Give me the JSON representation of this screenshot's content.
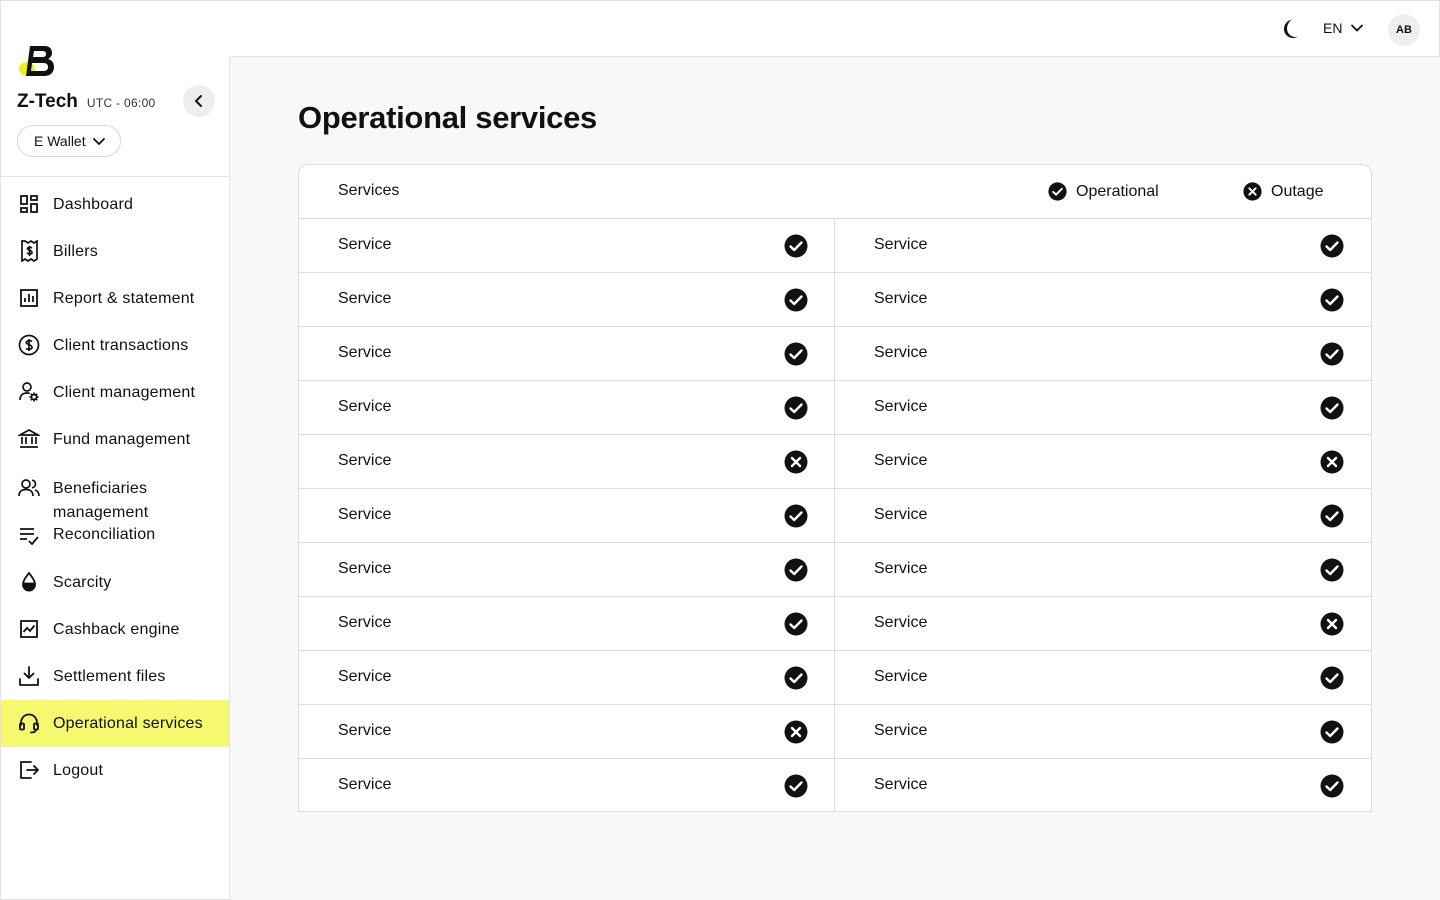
{
  "company": {
    "name": "Z-Tech",
    "timezone": "UTC - 06:00",
    "wallet": "E Wallet"
  },
  "topbar": {
    "language": "EN",
    "avatar_initials": "AB"
  },
  "nav": [
    {
      "label": "Dashboard",
      "icon": "dashboard-icon"
    },
    {
      "label": "Billers",
      "icon": "billers-icon"
    },
    {
      "label": "Report & statement",
      "icon": "report-icon"
    },
    {
      "label": "Client transactions",
      "icon": "dollar-icon"
    },
    {
      "label": "Client management",
      "icon": "user-gear-icon"
    },
    {
      "label": "Fund management",
      "icon": "bank-icon"
    },
    {
      "label": "Beneficiaries management",
      "icon": "users-icon"
    },
    {
      "label": "Reconciliation",
      "icon": "checklist-icon"
    },
    {
      "label": "Scarcity",
      "icon": "drop-icon"
    },
    {
      "label": "Cashback engine",
      "icon": "chart-line-icon"
    },
    {
      "label": "Settlement files",
      "icon": "download-icon"
    },
    {
      "label": "Operational services",
      "icon": "headset-icon",
      "active": true
    },
    {
      "label": "Logout",
      "icon": "logout-icon"
    }
  ],
  "page": {
    "title": "Operational services"
  },
  "table": {
    "header": "Services",
    "legend_operational": "Operational",
    "legend_outage": "Outage",
    "rows": [
      {
        "left": {
          "name": "Service",
          "status": "operational"
        },
        "right": {
          "name": "Service",
          "status": "operational"
        }
      },
      {
        "left": {
          "name": "Service",
          "status": "operational"
        },
        "right": {
          "name": "Service",
          "status": "operational"
        }
      },
      {
        "left": {
          "name": "Service",
          "status": "operational"
        },
        "right": {
          "name": "Service",
          "status": "operational"
        }
      },
      {
        "left": {
          "name": "Service",
          "status": "operational"
        },
        "right": {
          "name": "Service",
          "status": "operational"
        }
      },
      {
        "left": {
          "name": "Service",
          "status": "outage"
        },
        "right": {
          "name": "Service",
          "status": "outage"
        }
      },
      {
        "left": {
          "name": "Service",
          "status": "operational"
        },
        "right": {
          "name": "Service",
          "status": "operational"
        }
      },
      {
        "left": {
          "name": "Service",
          "status": "operational"
        },
        "right": {
          "name": "Service",
          "status": "operational"
        }
      },
      {
        "left": {
          "name": "Service",
          "status": "operational"
        },
        "right": {
          "name": "Service",
          "status": "outage"
        }
      },
      {
        "left": {
          "name": "Service",
          "status": "operational"
        },
        "right": {
          "name": "Service",
          "status": "operational"
        }
      },
      {
        "left": {
          "name": "Service",
          "status": "outage"
        },
        "right": {
          "name": "Service",
          "status": "operational"
        }
      },
      {
        "left": {
          "name": "Service",
          "status": "operational"
        },
        "right": {
          "name": "Service",
          "status": "operational"
        }
      }
    ]
  },
  "colors": {
    "accent": "#f6f970",
    "logo_yellow": "#eef21a"
  }
}
